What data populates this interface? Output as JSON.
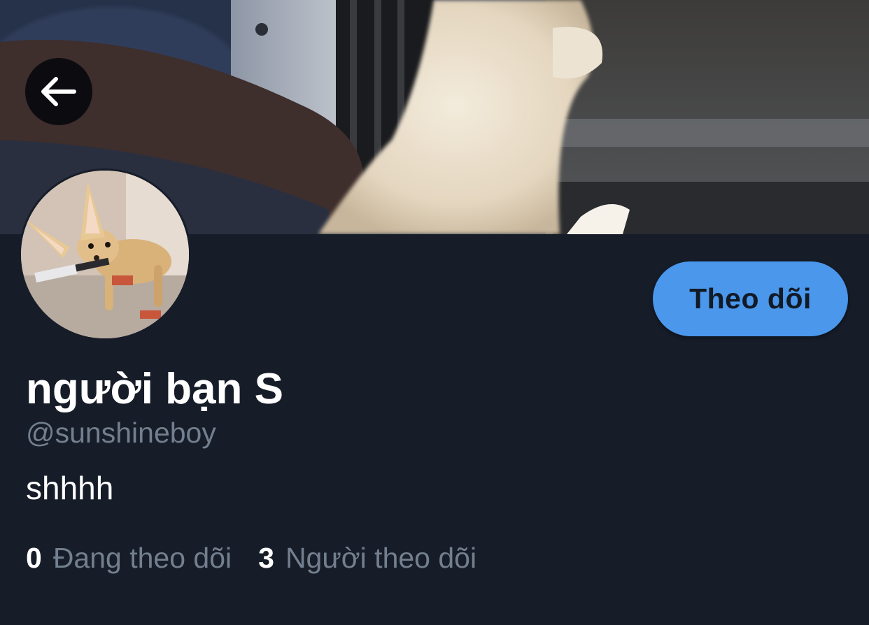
{
  "header": {
    "back_icon": "arrow-left-icon",
    "banner_image": "white-dog-at-window-photo"
  },
  "profile": {
    "avatar_image": "fennec-fox-with-knife-photo",
    "display_name": "người bạn S",
    "handle": "@sunshineboy",
    "bio": "shhhh",
    "follow_label": "Theo dõi",
    "following_count": "0",
    "following_label": "Đang theo dõi",
    "followers_count": "3",
    "followers_label": "Người theo dõi"
  },
  "colors": {
    "background": "#161d29",
    "accent": "#4a97ec",
    "secondary_text": "#737f8e",
    "primary_text": "#ffffff"
  }
}
